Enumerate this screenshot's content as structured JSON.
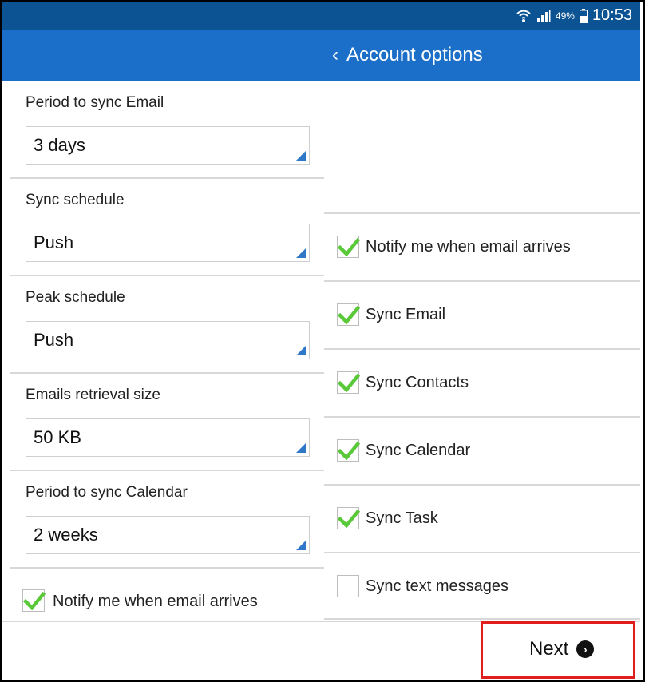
{
  "status_bar": {
    "battery_percent": "49%",
    "time": "10:53",
    "icons": [
      "wifi-icon",
      "signal-icon",
      "battery-icon"
    ]
  },
  "app_bar": {
    "back_glyph": "‹",
    "title": "Account options"
  },
  "left_settings": [
    {
      "label": "Period to sync Email",
      "value": "3 days"
    },
    {
      "label": "Sync schedule",
      "value": "Push"
    },
    {
      "label": "Peak schedule",
      "value": "Push"
    },
    {
      "label": "Emails retrieval size",
      "value": "50 KB"
    },
    {
      "label": "Period to sync Calendar",
      "value": "2 weeks"
    }
  ],
  "left_checkbox": {
    "label": "Notify me when email arrives",
    "checked": true
  },
  "right_checkboxes": [
    {
      "label": "Notify me when email arrives",
      "checked": true
    },
    {
      "label": "Sync Email",
      "checked": true
    },
    {
      "label": "Sync Contacts",
      "checked": true
    },
    {
      "label": "Sync Calendar",
      "checked": true
    },
    {
      "label": "Sync Task",
      "checked": true
    },
    {
      "label": "Sync text messages",
      "checked": false
    }
  ],
  "footer": {
    "next_label": "Next",
    "next_icon_glyph": "›"
  },
  "colors": {
    "status_bar": "#0c5394",
    "app_bar": "#1b6fc8",
    "check_green": "#59c93a",
    "highlight_red": "#e01e1e",
    "select_triangle": "#2f78c8"
  }
}
